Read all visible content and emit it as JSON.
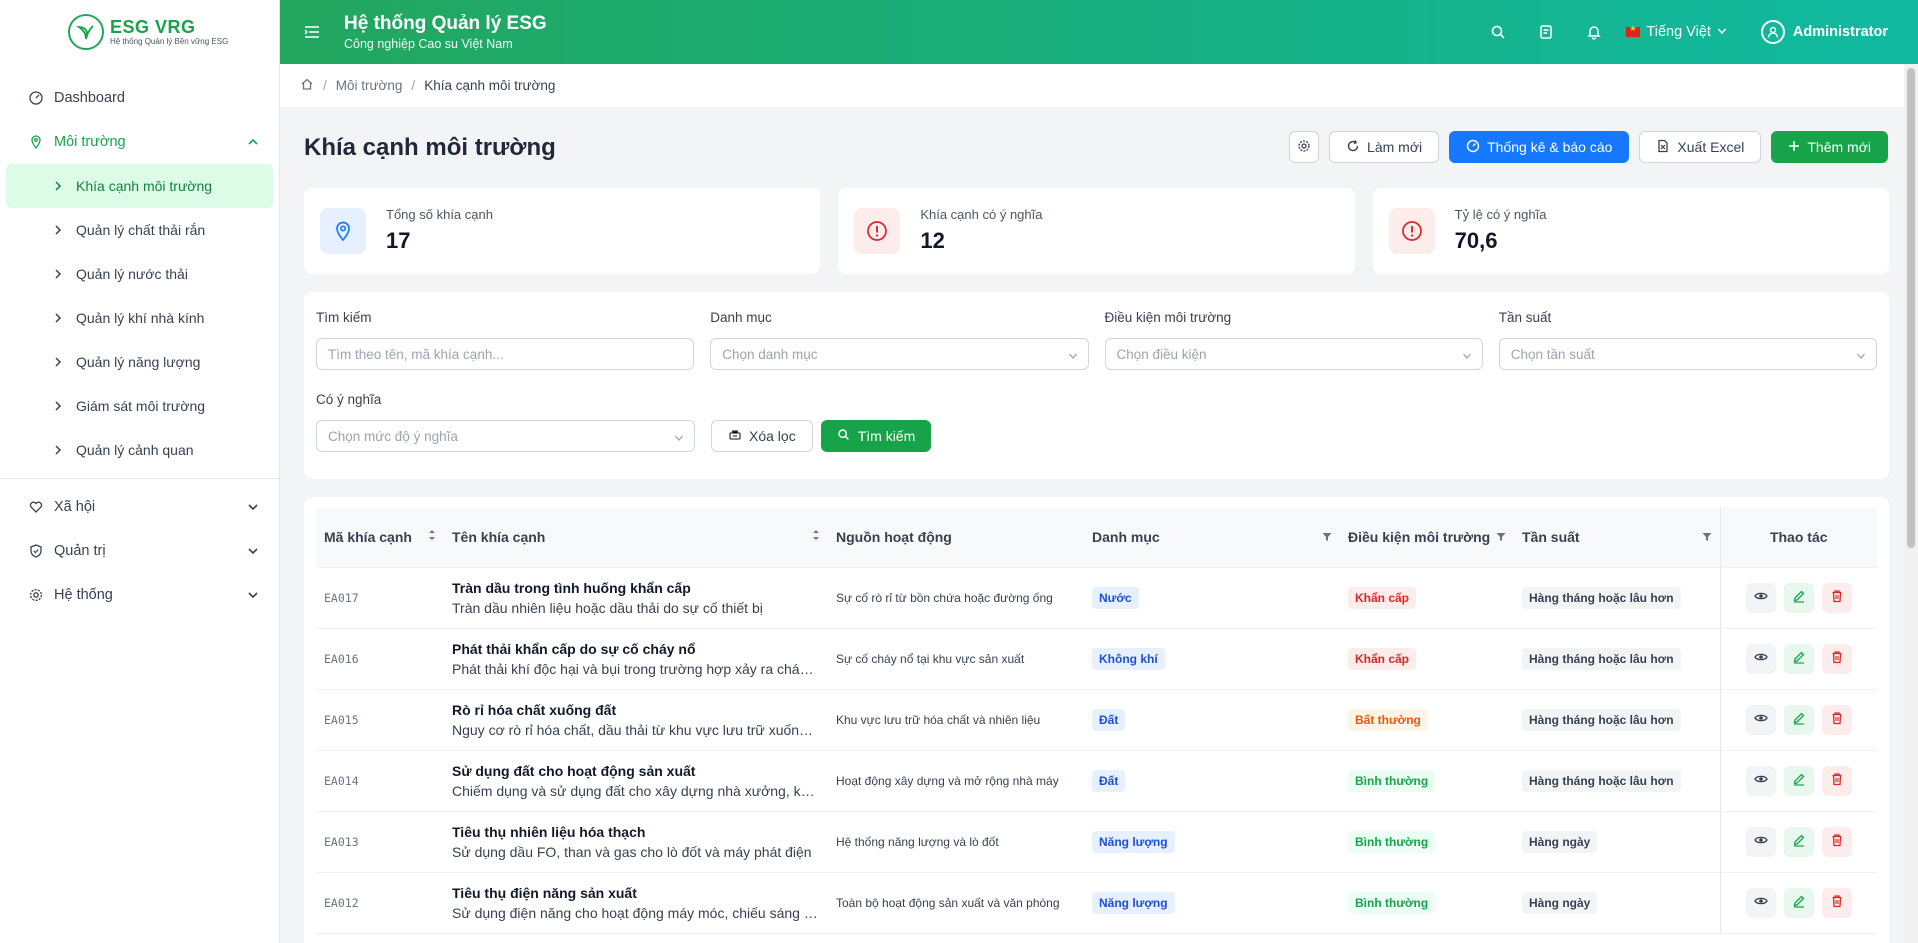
{
  "brand": {
    "name": "ESG VRG",
    "tagline": "Hệ thống Quản lý Bền vững ESG",
    "mark_text": "Cao su Việt Nam"
  },
  "header": {
    "title": "Hệ thống Quản lý ESG",
    "subtitle": "Công nghiệp Cao su Việt Nam",
    "language": "Tiếng Việt",
    "user": "Administrator"
  },
  "sidebar": {
    "items": [
      {
        "label": "Dashboard"
      },
      {
        "label": "Môi trường"
      },
      {
        "label": "Xã hội"
      },
      {
        "label": "Quản trị"
      },
      {
        "label": "Hệ thống"
      }
    ],
    "sub_items": [
      {
        "label": "Khía cạnh môi trường"
      },
      {
        "label": "Quản lý chất thải rắn"
      },
      {
        "label": "Quản lý nước thải"
      },
      {
        "label": "Quản lý khí nhà kính"
      },
      {
        "label": "Quản lý năng lượng"
      },
      {
        "label": "Giám sát môi trường"
      },
      {
        "label": "Quản lý cảnh quan"
      }
    ]
  },
  "breadcrumb": {
    "parent": "Môi trường",
    "current": "Khía cạnh môi trường"
  },
  "page": {
    "title": "Khía cạnh môi trường"
  },
  "toolbar": {
    "refresh": "Làm mới",
    "report": "Thống kê & báo cáo",
    "export": "Xuất Excel",
    "add": "Thêm mới"
  },
  "stats": [
    {
      "label": "Tổng số khía cạnh",
      "value": "17"
    },
    {
      "label": "Khía cạnh có ý nghĩa",
      "value": "12"
    },
    {
      "label": "Tỷ lệ có ý nghĩa",
      "value": "70,6"
    }
  ],
  "filters": {
    "search_label": "Tìm kiếm",
    "search_placeholder": "Tìm theo tên, mã khía cạnh...",
    "category_label": "Danh mục",
    "category_placeholder": "Chọn danh mục",
    "condition_label": "Điều kiện môi trường",
    "condition_placeholder": "Chọn điều kiện",
    "frequency_label": "Tần suất",
    "frequency_placeholder": "Chọn tần suất",
    "significance_label": "Có ý nghĩa",
    "significance_placeholder": "Chọn mức độ ý nghĩa",
    "clear": "Xóa lọc",
    "search": "Tìm kiếm"
  },
  "table": {
    "columns": [
      "Mã khía cạnh",
      "Tên khía cạnh",
      "Nguồn hoạt động",
      "Danh mục",
      "Điều kiện môi trường",
      "Tần suất",
      "Thao tác"
    ],
    "rows": [
      {
        "code": "EA017",
        "name": "Tràn dầu trong tình huống khẩn cấp",
        "desc": "Tràn dầu nhiên liệu hoặc dầu thải do sự cố thiết bị",
        "source": "Sự cố rò rỉ từ bồn chứa hoặc đường ống",
        "category": "Nước",
        "condition": "Khẩn cấp",
        "condition_color": "red",
        "frequency": "Hàng tháng hoặc lâu hơn"
      },
      {
        "code": "EA016",
        "name": "Phát thải khẩn cấp do sự cố cháy nổ",
        "desc": "Phát thải khí độc hại và bụi trong trường hợp xảy ra cháy nổ",
        "source": "Sự cố cháy nổ tại khu vực sản xuất",
        "category": "Không khí",
        "condition": "Khẩn cấp",
        "condition_color": "red",
        "frequency": "Hàng tháng hoặc lâu hơn"
      },
      {
        "code": "EA015",
        "name": "Rò rỉ hóa chất xuống đất",
        "desc": "Nguy cơ rò rỉ hóa chất, dầu thải từ khu vực lưu trữ xuống đất",
        "source": "Khu vực lưu trữ hóa chất và nhiên liệu",
        "category": "Đất",
        "condition": "Bất thường",
        "condition_color": "orange",
        "frequency": "Hàng tháng hoặc lâu hơn"
      },
      {
        "code": "EA014",
        "name": "Sử dụng đất cho hoạt động sản xuất",
        "desc": "Chiếm dụng và sử dụng đất cho xây dựng nhà xưởng, kho bãi",
        "source": "Hoạt động xây dựng và mở rộng nhà máy",
        "category": "Đất",
        "condition": "Bình thường",
        "condition_color": "green",
        "frequency": "Hàng tháng hoặc lâu hơn"
      },
      {
        "code": "EA013",
        "name": "Tiêu thụ nhiên liệu hóa thạch",
        "desc": "Sử dụng dầu FO, than và gas cho lò đốt và máy phát điện",
        "source": "Hệ thống năng lượng và lò đốt",
        "category": "Năng lượng",
        "condition": "Bình thường",
        "condition_color": "green",
        "frequency": "Hàng ngày"
      },
      {
        "code": "EA012",
        "name": "Tiêu thụ điện năng sản xuất",
        "desc": "Sử dụng điện năng cho hoạt động máy móc, chiếu sáng văn phòng",
        "source": "Toàn bộ hoạt động sản xuất và văn phòng",
        "category": "Năng lượng",
        "condition": "Bình thường",
        "condition_color": "green",
        "frequency": "Hàng ngày"
      }
    ]
  },
  "colors": {
    "primary": "#16a34a",
    "accent": "#10b9a0",
    "blue": "#1677ff"
  }
}
